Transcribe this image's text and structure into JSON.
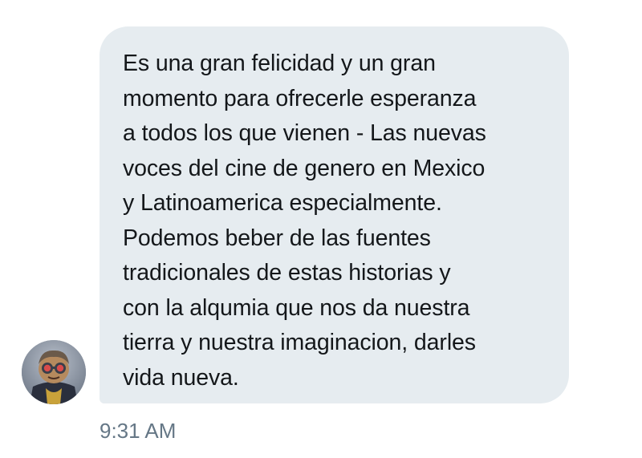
{
  "conversation": {
    "message": {
      "lines": [
        "Es una gran felicidad y un gran",
        "momento para ofrecerle esperanza",
        "a todos los que vienen - Las nuevas",
        "voces del cine de genero en Mexico",
        "y Latinoamerica especialmente.",
        "Podemos beber de las fuentes",
        "tradicionales de estas historias y",
        "con la alqumia que nos da nuestra",
        "tierra y nuestra imaginacion, darles",
        "vida nueva."
      ],
      "timestamp": "9:31 AM"
    },
    "sender": {
      "avatar_icon": "user-avatar-figure",
      "bubble_color": "#e6ecf0",
      "text_color": "#14171a",
      "meta_color": "#657786"
    }
  }
}
